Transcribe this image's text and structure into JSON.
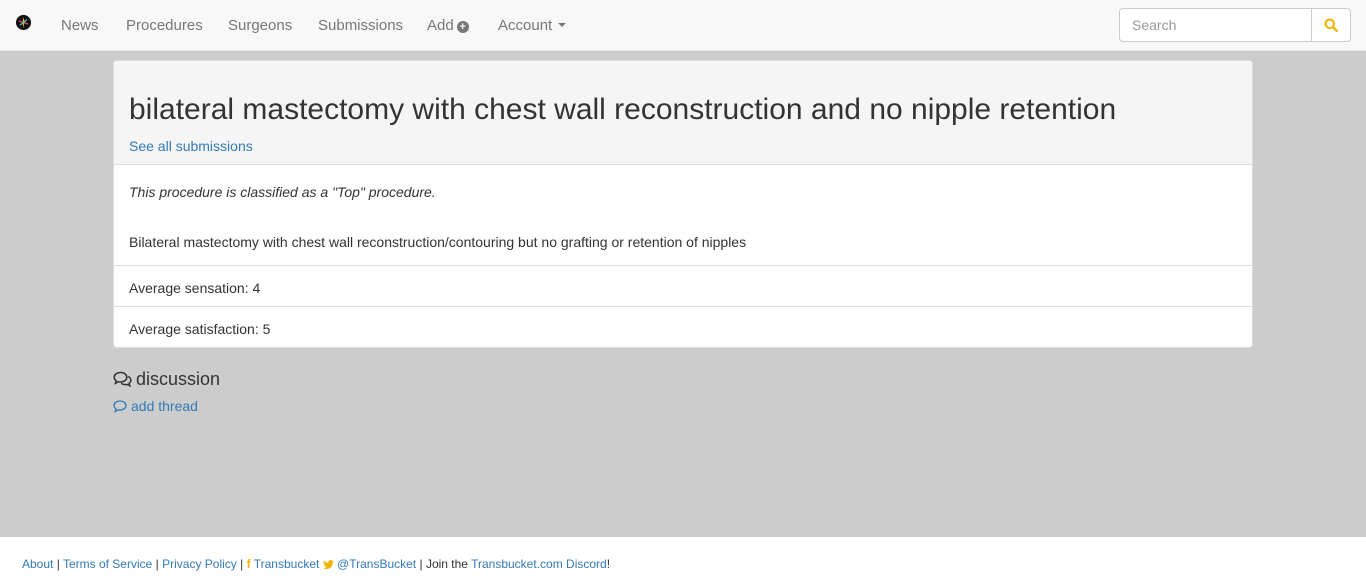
{
  "navbar": {
    "items": [
      {
        "label": "News"
      },
      {
        "label": "Procedures"
      },
      {
        "label": "Surgeons"
      },
      {
        "label": "Submissions"
      },
      {
        "label": "Add"
      },
      {
        "label": "Account"
      }
    ],
    "search": {
      "placeholder": "Search",
      "value": ""
    },
    "icons": {
      "brand": "transbucket-logo-icon",
      "add": "plus-circle-icon",
      "account": "caret-down-icon",
      "search": "search-icon"
    },
    "accent_color": "#f0b400"
  },
  "procedure": {
    "title": "bilateral mastectomy with chest wall reconstruction and no nipple retention",
    "see_all_link": "See all submissions",
    "classification": "This procedure is classified as a \"Top\" procedure.",
    "description": "Bilateral mastectomy with chest wall reconstruction/contouring but no grafting or retention of nipples",
    "average_sensation": "Average sensation: 4",
    "average_satisfaction": "Average satisfaction: 5"
  },
  "discussion": {
    "heading": "discussion",
    "add_thread": "add thread",
    "icons": {
      "heading": "comments-icon",
      "add_thread": "comment-outline-icon"
    }
  },
  "footer": {
    "about": "About",
    "sep": "|",
    "terms": "Terms of Service",
    "privacy": "Privacy Policy",
    "facebook": "Transbucket",
    "twitter": "@TransBucket",
    "join_prefix": "Join the",
    "discord": "Transbucket.com Discord",
    "join_suffix": "!",
    "fb_glyph": "f"
  }
}
